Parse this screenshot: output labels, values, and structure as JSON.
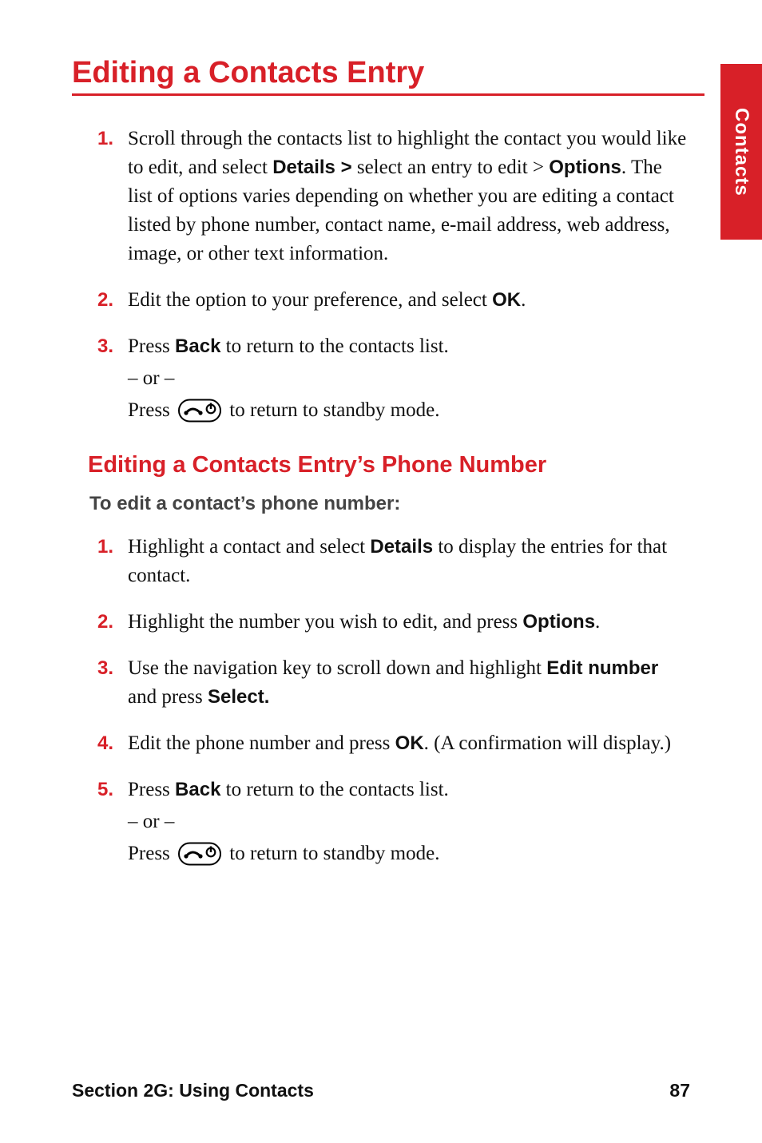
{
  "sideTab": "Contacts",
  "title": "Editing a Contacts Entry",
  "steps1": [
    {
      "num": "1.",
      "parts": [
        {
          "t": "Scroll through the contacts list to highlight the contact you would like to edit, and select "
        },
        {
          "t": "Details >",
          "b": true
        },
        {
          "t": " select an entry to edit > "
        },
        {
          "t": "Options",
          "b": true
        },
        {
          "t": ". The list of options varies depending on whether you are editing a contact listed by phone number, contact name, e-mail address, web address, image, or other text information."
        }
      ]
    },
    {
      "num": "2.",
      "parts": [
        {
          "t": "Edit the option to your preference, and select "
        },
        {
          "t": "OK",
          "b": true
        },
        {
          "t": "."
        }
      ]
    },
    {
      "num": "3.",
      "parts": [
        {
          "t": "Press "
        },
        {
          "t": "Back",
          "b": true
        },
        {
          "t": " to return to the contacts list."
        }
      ],
      "orLine": "– or –",
      "afterParts": [
        {
          "t": "Press "
        },
        {
          "icon": "end-key"
        },
        {
          "t": " to return to standby mode."
        }
      ]
    }
  ],
  "subhead": "Editing a Contacts Entry’s Phone Number",
  "lead": "To edit a contact’s phone number:",
  "steps2": [
    {
      "num": "1.",
      "parts": [
        {
          "t": "Highlight a contact and select "
        },
        {
          "t": "Details",
          "b": true
        },
        {
          "t": " to display the entries for that contact."
        }
      ]
    },
    {
      "num": "2.",
      "parts": [
        {
          "t": "Highlight the number you wish to edit, and press "
        },
        {
          "t": "Options",
          "b": true
        },
        {
          "t": "."
        }
      ]
    },
    {
      "num": "3.",
      "parts": [
        {
          "t": "Use the navigation key to scroll down and highlight "
        },
        {
          "t": "Edit number",
          "b": true
        },
        {
          "t": " and press "
        },
        {
          "t": "Select.",
          "b": true
        }
      ]
    },
    {
      "num": "4.",
      "parts": [
        {
          "t": "Edit the phone number and press "
        },
        {
          "t": "OK",
          "b": true
        },
        {
          "t": ". (A confirmation will display.)"
        }
      ]
    },
    {
      "num": "5.",
      "parts": [
        {
          "t": "Press "
        },
        {
          "t": "Back",
          "b": true
        },
        {
          "t": " to return to the contacts list."
        }
      ],
      "orLine": "– or –",
      "afterParts": [
        {
          "t": "Press "
        },
        {
          "icon": "end-key"
        },
        {
          "t": " to return to standby mode."
        }
      ]
    }
  ],
  "footerLeft": "Section 2G: Using Contacts",
  "footerRight": "87"
}
